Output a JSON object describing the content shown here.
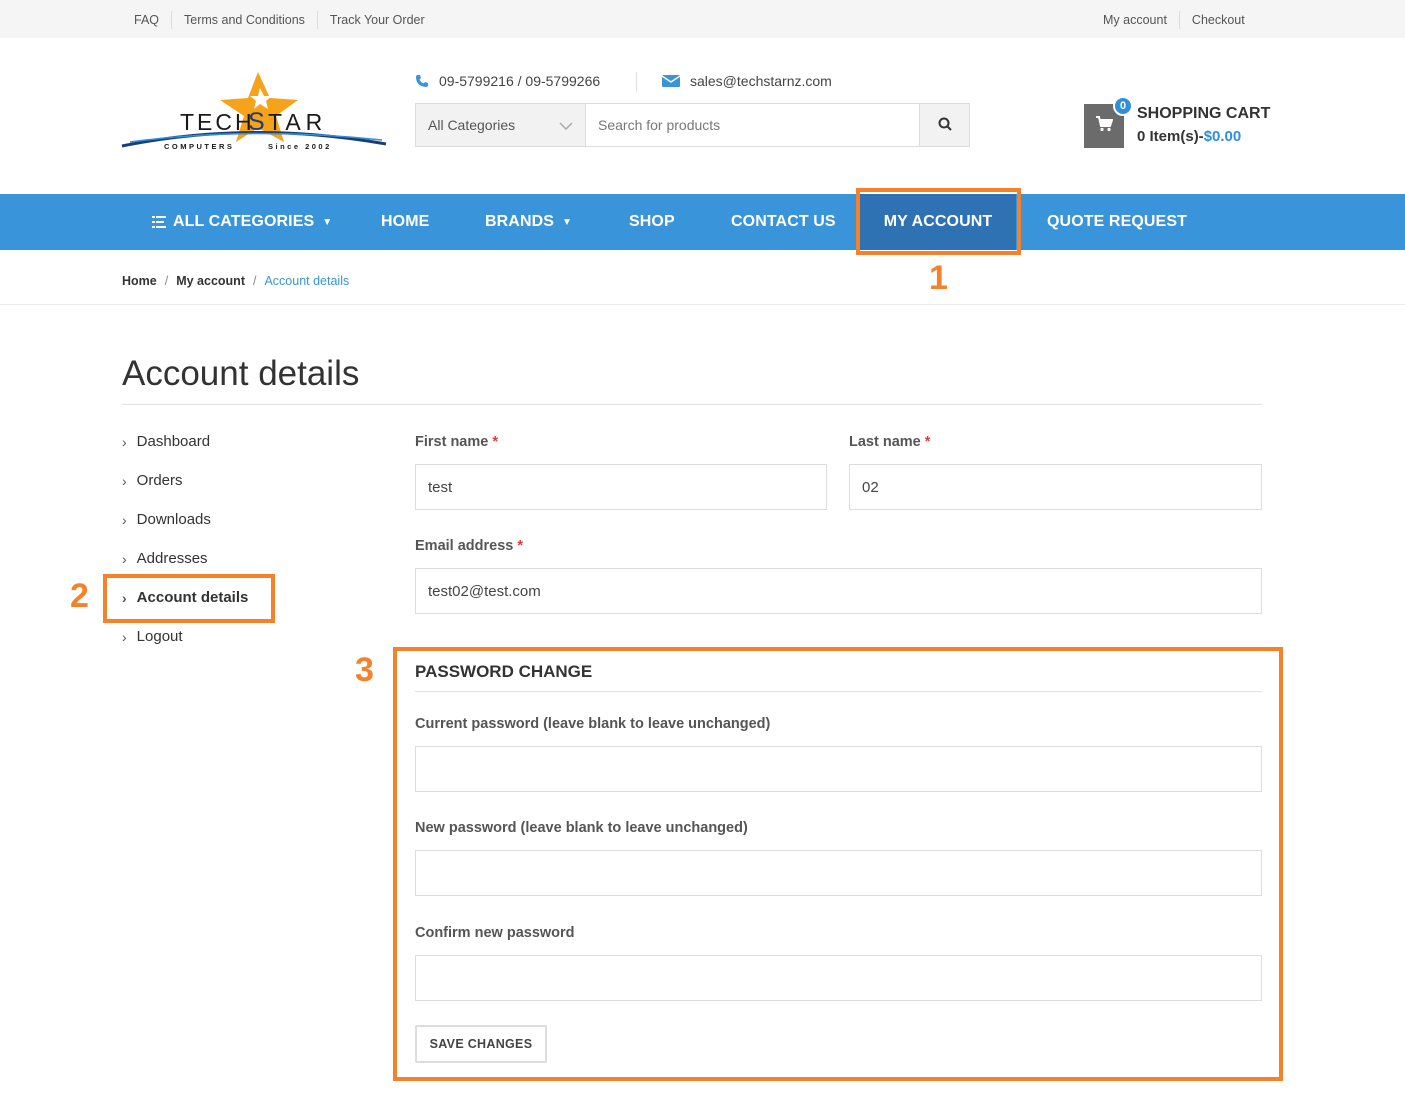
{
  "topbar": {
    "left_links": [
      "FAQ",
      "Terms and Conditions",
      "Track Your Order"
    ],
    "right_links": [
      "My account",
      "Checkout"
    ]
  },
  "header": {
    "logo_text": "TECHSTAR",
    "logo_tagline": "COMPUTERS  Since 2002",
    "phone": "09-5799216 / 09-5799266",
    "email": "sales@techstarnz.com",
    "search": {
      "category": "All Categories",
      "placeholder": "Search for products"
    },
    "cart": {
      "badge": "0",
      "title": "SHOPPING CART",
      "items": "0 Item(s)-",
      "amount": "$0.00"
    }
  },
  "nav": {
    "items": [
      "ALL CATEGORIES",
      "HOME",
      "BRANDS",
      "SHOP",
      "CONTACT US",
      "MY ACCOUNT",
      "QUOTE REQUEST"
    ],
    "active": "MY ACCOUNT"
  },
  "breadcrumb": {
    "items": [
      "Home",
      "My account"
    ],
    "current": "Account details"
  },
  "page": {
    "title": "Account details"
  },
  "sidebar": {
    "items": [
      "Dashboard",
      "Orders",
      "Downloads",
      "Addresses",
      "Account details",
      "Logout"
    ],
    "active": "Account details"
  },
  "form": {
    "first_name": {
      "label": "First name",
      "value": "test"
    },
    "last_name": {
      "label": "Last name",
      "value": "02"
    },
    "email": {
      "label": "Email address",
      "value": "test02@test.com"
    },
    "required_marker": "*",
    "password_section": "PASSWORD CHANGE",
    "current_password": {
      "label": "Current password (leave blank to leave unchanged)",
      "value": ""
    },
    "new_password": {
      "label": "New password (leave blank to leave unchanged)",
      "value": ""
    },
    "confirm_password": {
      "label": "Confirm new password",
      "value": ""
    },
    "save_label": "SAVE CHANGES"
  },
  "annotations": [
    "1",
    "2",
    "3"
  ],
  "colors": {
    "nav_bg": "#3a94d9",
    "nav_active": "#2f72b3",
    "annotation": "#f5822a",
    "link_blue": "#3a94d9"
  }
}
